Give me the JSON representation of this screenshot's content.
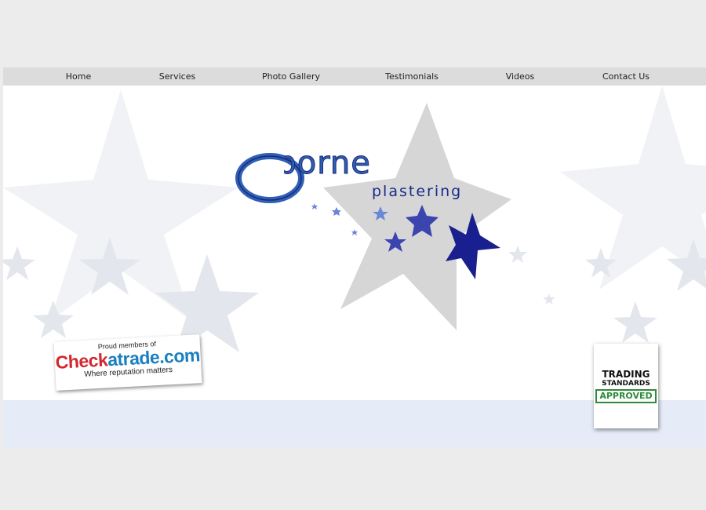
{
  "nav": {
    "items": [
      {
        "label": "Home"
      },
      {
        "label": "Services"
      },
      {
        "label": "Photo Gallery"
      },
      {
        "label": "Testimonials"
      },
      {
        "label": "Videos"
      },
      {
        "label": "Contact Us"
      }
    ]
  },
  "logo": {
    "name": "Osborne",
    "tagline": "plastering"
  },
  "checkatrade": {
    "top_text": "Proud members of",
    "brand_check": "Chec",
    "brand_k": "k",
    "brand_trade": "atrade.com",
    "slogan": "Where reputation matters"
  },
  "trading_standards": {
    "line1": "TRADING",
    "line2": "STANDARDS",
    "line3": "APPROVED"
  },
  "colors": {
    "nav_bg": "#dcdcdc",
    "logo_blue": "#2f5fb8",
    "star_dark": "#1a1f8f",
    "star_mid": "#3a45b0",
    "star_light": "#6a86d6",
    "bg_star": "#e4e6ee",
    "big_star": "#d6d6d6",
    "approved_green": "#2e8b3a"
  }
}
